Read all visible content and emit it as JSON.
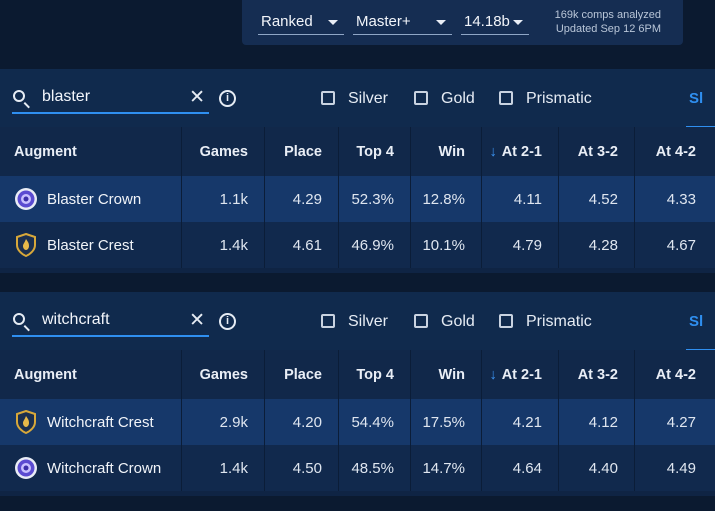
{
  "filters": {
    "mode": "Ranked",
    "rank": "Master+",
    "patch": "14.18b",
    "comps_analyzed": "169k comps analyzed",
    "updated": "Updated Sep 12 6PM"
  },
  "headers": {
    "augment": "Augment",
    "games": "Games",
    "place": "Place",
    "top4": "Top 4",
    "win": "Win",
    "at21": "At 2-1",
    "at32": "At 3-2",
    "at42": "At 4-2"
  },
  "checkboxes": {
    "silver": "Silver",
    "gold": "Gold",
    "prismatic": "Prismatic"
  },
  "side_tab": "Sl",
  "panels": [
    {
      "search": "blaster",
      "rows": [
        {
          "icon": "crown-icon",
          "name": "Blaster Crown",
          "games": "1.1k",
          "place": "4.29",
          "top4": "52.3%",
          "win": "12.8%",
          "at21": "4.11",
          "at32": "4.52",
          "at42": "4.33"
        },
        {
          "icon": "crest-icon",
          "name": "Blaster Crest",
          "games": "1.4k",
          "place": "4.61",
          "top4": "46.9%",
          "win": "10.1%",
          "at21": "4.79",
          "at32": "4.28",
          "at42": "4.67"
        }
      ]
    },
    {
      "search": "witchcraft",
      "rows": [
        {
          "icon": "crest-icon",
          "name": "Witchcraft Crest",
          "games": "2.9k",
          "place": "4.20",
          "top4": "54.4%",
          "win": "17.5%",
          "at21": "4.21",
          "at32": "4.12",
          "at42": "4.27"
        },
        {
          "icon": "crown-icon",
          "name": "Witchcraft Crown",
          "games": "1.4k",
          "place": "4.50",
          "top4": "48.5%",
          "win": "14.7%",
          "at21": "4.64",
          "at32": "4.40",
          "at42": "4.49"
        }
      ]
    }
  ],
  "colors": {
    "accent": "#2f8ff0",
    "gold": "#d8a83a",
    "crown": "#5b4bd1"
  }
}
